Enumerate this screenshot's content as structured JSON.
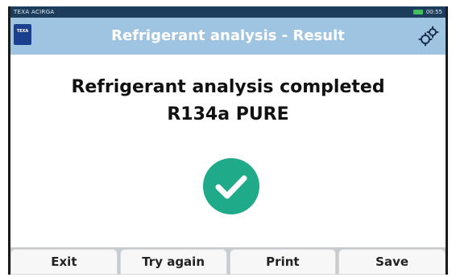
{
  "statusbar": {
    "brand": "TEXA ACIRGA",
    "time": "00:55"
  },
  "header": {
    "logo_text": "TEXA",
    "title": "Refrigerant analysis - Result",
    "settings_icon": "gears-icon"
  },
  "result": {
    "message": "Refrigerant analysis completed",
    "refrigerant": "R134a PURE",
    "status_icon": "check-circle-icon",
    "status_color": "#1faa8a"
  },
  "buttons": {
    "exit": "Exit",
    "try_again": "Try again",
    "print": "Print",
    "save": "Save"
  },
  "colors": {
    "title_bar": "#9fc4e2",
    "status_bar": "#1c3d5c",
    "logo": "#1b3f8f",
    "battery": "#3fc05b"
  }
}
